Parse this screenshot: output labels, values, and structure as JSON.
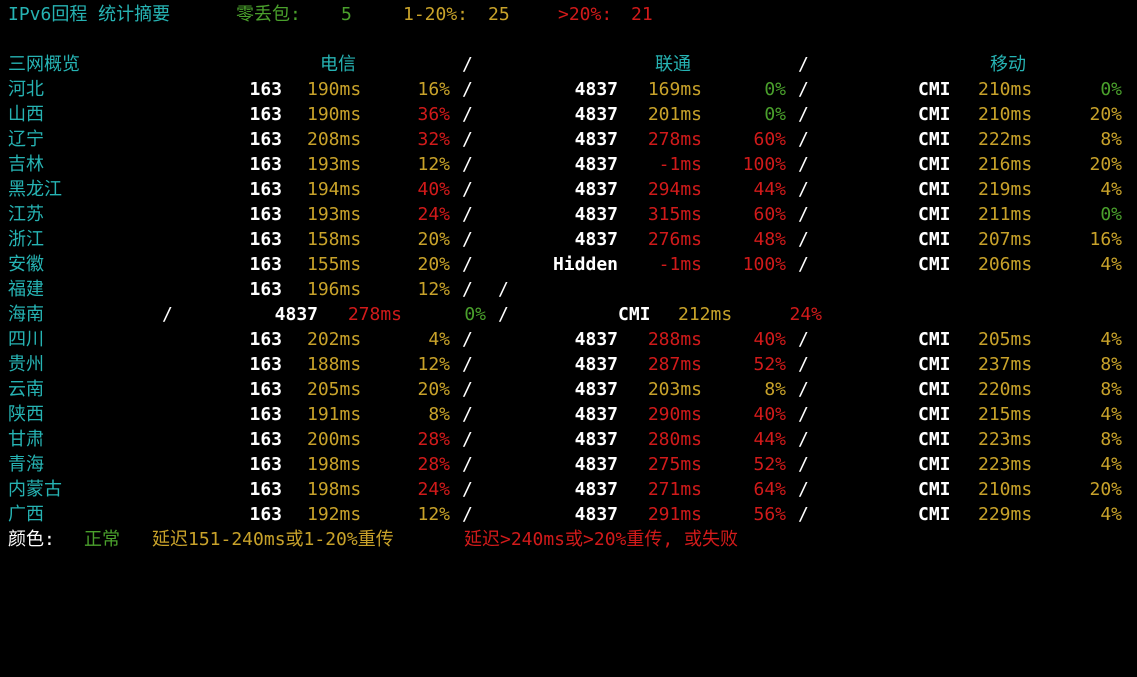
{
  "summary": {
    "title": "IPv6回程 统计摘要",
    "zero_label": "零丢包:",
    "zero_value": "5",
    "mid_label": "1-20%:",
    "mid_value": "25",
    "high_label": ">20%:",
    "high_value": "21"
  },
  "header": {
    "col0": "三网概览",
    "telecom": "电信",
    "unicom": "联通",
    "mobile": "移动",
    "sep": "/"
  },
  "rows": [
    {
      "prov": "河北",
      "t_as": "163",
      "t_lat": "190ms",
      "t_loss": "16%",
      "t_c": "yellow",
      "t_lc": "yellow",
      "u_as": "4837",
      "u_lat": "169ms",
      "u_loss": "0%",
      "u_c": "yellow",
      "u_lc": "green",
      "m_as": "CMI",
      "m_lat": "210ms",
      "m_loss": "0%",
      "m_c": "yellow",
      "m_lc": "green"
    },
    {
      "prov": "山西",
      "t_as": "163",
      "t_lat": "190ms",
      "t_loss": "36%",
      "t_c": "yellow",
      "t_lc": "red",
      "u_as": "4837",
      "u_lat": "201ms",
      "u_loss": "0%",
      "u_c": "yellow",
      "u_lc": "green",
      "m_as": "CMI",
      "m_lat": "210ms",
      "m_loss": "20%",
      "m_c": "yellow",
      "m_lc": "yellow"
    },
    {
      "prov": "辽宁",
      "t_as": "163",
      "t_lat": "208ms",
      "t_loss": "32%",
      "t_c": "yellow",
      "t_lc": "red",
      "u_as": "4837",
      "u_lat": "278ms",
      "u_loss": "60%",
      "u_c": "red",
      "u_lc": "red",
      "m_as": "CMI",
      "m_lat": "222ms",
      "m_loss": "8%",
      "m_c": "yellow",
      "m_lc": "yellow"
    },
    {
      "prov": "吉林",
      "t_as": "163",
      "t_lat": "193ms",
      "t_loss": "12%",
      "t_c": "yellow",
      "t_lc": "yellow",
      "u_as": "4837",
      "u_lat": "-1ms",
      "u_loss": "100%",
      "u_c": "red",
      "u_lc": "red",
      "m_as": "CMI",
      "m_lat": "216ms",
      "m_loss": "20%",
      "m_c": "yellow",
      "m_lc": "yellow"
    },
    {
      "prov": "黑龙江",
      "t_as": "163",
      "t_lat": "194ms",
      "t_loss": "40%",
      "t_c": "yellow",
      "t_lc": "red",
      "u_as": "4837",
      "u_lat": "294ms",
      "u_loss": "44%",
      "u_c": "red",
      "u_lc": "red",
      "m_as": "CMI",
      "m_lat": "219ms",
      "m_loss": "4%",
      "m_c": "yellow",
      "m_lc": "yellow"
    },
    {
      "prov": "江苏",
      "t_as": "163",
      "t_lat": "193ms",
      "t_loss": "24%",
      "t_c": "yellow",
      "t_lc": "red",
      "u_as": "4837",
      "u_lat": "315ms",
      "u_loss": "60%",
      "u_c": "red",
      "u_lc": "red",
      "m_as": "CMI",
      "m_lat": "211ms",
      "m_loss": "0%",
      "m_c": "yellow",
      "m_lc": "green"
    },
    {
      "prov": "浙江",
      "t_as": "163",
      "t_lat": "158ms",
      "t_loss": "20%",
      "t_c": "yellow",
      "t_lc": "yellow",
      "u_as": "4837",
      "u_lat": "276ms",
      "u_loss": "48%",
      "u_c": "red",
      "u_lc": "red",
      "m_as": "CMI",
      "m_lat": "207ms",
      "m_loss": "16%",
      "m_c": "yellow",
      "m_lc": "yellow"
    },
    {
      "prov": "安徽",
      "t_as": "163",
      "t_lat": "155ms",
      "t_loss": "20%",
      "t_c": "yellow",
      "t_lc": "yellow",
      "u_as": "Hidden",
      "u_lat": "-1ms",
      "u_loss": "100%",
      "u_c": "red",
      "u_lc": "red",
      "m_as": "CMI",
      "m_lat": "206ms",
      "m_loss": "4%",
      "m_c": "yellow",
      "m_lc": "yellow"
    },
    {
      "prov": "福建",
      "t_as": "163",
      "t_lat": "196ms",
      "t_loss": "12%",
      "t_c": "yellow",
      "t_lc": "yellow",
      "u_as": "",
      "u_lat": "",
      "u_loss": "",
      "u_c": "yellow",
      "u_lc": "yellow",
      "m_as": "",
      "m_lat": "",
      "m_loss": "",
      "m_c": "yellow",
      "m_lc": "yellow"
    },
    {
      "prov": "海南",
      "t_as": "",
      "t_lat": "",
      "t_loss": "",
      "t_c": "yellow",
      "t_lc": "yellow",
      "u_as": "4837",
      "u_lat": "278ms",
      "u_loss": "0%",
      "u_c": "red",
      "u_lc": "green",
      "m_as": "CMI",
      "m_lat": "212ms",
      "m_loss": "24%",
      "m_c": "yellow",
      "m_lc": "red"
    },
    {
      "prov": "四川",
      "t_as": "163",
      "t_lat": "202ms",
      "t_loss": "4%",
      "t_c": "yellow",
      "t_lc": "yellow",
      "u_as": "4837",
      "u_lat": "288ms",
      "u_loss": "40%",
      "u_c": "red",
      "u_lc": "red",
      "m_as": "CMI",
      "m_lat": "205ms",
      "m_loss": "4%",
      "m_c": "yellow",
      "m_lc": "yellow"
    },
    {
      "prov": "贵州",
      "t_as": "163",
      "t_lat": "188ms",
      "t_loss": "12%",
      "t_c": "yellow",
      "t_lc": "yellow",
      "u_as": "4837",
      "u_lat": "287ms",
      "u_loss": "52%",
      "u_c": "red",
      "u_lc": "red",
      "m_as": "CMI",
      "m_lat": "237ms",
      "m_loss": "8%",
      "m_c": "yellow",
      "m_lc": "yellow"
    },
    {
      "prov": "云南",
      "t_as": "163",
      "t_lat": "205ms",
      "t_loss": "20%",
      "t_c": "yellow",
      "t_lc": "yellow",
      "u_as": "4837",
      "u_lat": "203ms",
      "u_loss": "8%",
      "u_c": "yellow",
      "u_lc": "yellow",
      "m_as": "CMI",
      "m_lat": "220ms",
      "m_loss": "8%",
      "m_c": "yellow",
      "m_lc": "yellow"
    },
    {
      "prov": "陕西",
      "t_as": "163",
      "t_lat": "191ms",
      "t_loss": "8%",
      "t_c": "yellow",
      "t_lc": "yellow",
      "u_as": "4837",
      "u_lat": "290ms",
      "u_loss": "40%",
      "u_c": "red",
      "u_lc": "red",
      "m_as": "CMI",
      "m_lat": "215ms",
      "m_loss": "4%",
      "m_c": "yellow",
      "m_lc": "yellow"
    },
    {
      "prov": "甘肃",
      "t_as": "163",
      "t_lat": "200ms",
      "t_loss": "28%",
      "t_c": "yellow",
      "t_lc": "red",
      "u_as": "4837",
      "u_lat": "280ms",
      "u_loss": "44%",
      "u_c": "red",
      "u_lc": "red",
      "m_as": "CMI",
      "m_lat": "223ms",
      "m_loss": "8%",
      "m_c": "yellow",
      "m_lc": "yellow"
    },
    {
      "prov": "青海",
      "t_as": "163",
      "t_lat": "198ms",
      "t_loss": "28%",
      "t_c": "yellow",
      "t_lc": "red",
      "u_as": "4837",
      "u_lat": "275ms",
      "u_loss": "52%",
      "u_c": "red",
      "u_lc": "red",
      "m_as": "CMI",
      "m_lat": "223ms",
      "m_loss": "4%",
      "m_c": "yellow",
      "m_lc": "yellow"
    },
    {
      "prov": "内蒙古",
      "t_as": "163",
      "t_lat": "198ms",
      "t_loss": "24%",
      "t_c": "yellow",
      "t_lc": "red",
      "u_as": "4837",
      "u_lat": "271ms",
      "u_loss": "64%",
      "u_c": "red",
      "u_lc": "red",
      "m_as": "CMI",
      "m_lat": "210ms",
      "m_loss": "20%",
      "m_c": "yellow",
      "m_lc": "yellow"
    },
    {
      "prov": "广西",
      "t_as": "163",
      "t_lat": "192ms",
      "t_loss": "12%",
      "t_c": "yellow",
      "t_lc": "yellow",
      "u_as": "4837",
      "u_lat": "291ms",
      "u_loss": "56%",
      "u_c": "red",
      "u_lc": "red",
      "m_as": "CMI",
      "m_lat": "229ms",
      "m_loss": "4%",
      "m_c": "yellow",
      "m_lc": "yellow"
    }
  ],
  "legend": {
    "label": "颜色:",
    "normal": "正常",
    "mid": "延迟151-240ms或1-20%重传",
    "bad": "延迟>240ms或>20%重传, 或失败"
  },
  "colors": {
    "background": "#000000",
    "cyan": "#26b3b3",
    "green": "#4aa02c",
    "yellow": "#c8a22a",
    "red": "#d11a1a",
    "white": "#ffffff"
  }
}
